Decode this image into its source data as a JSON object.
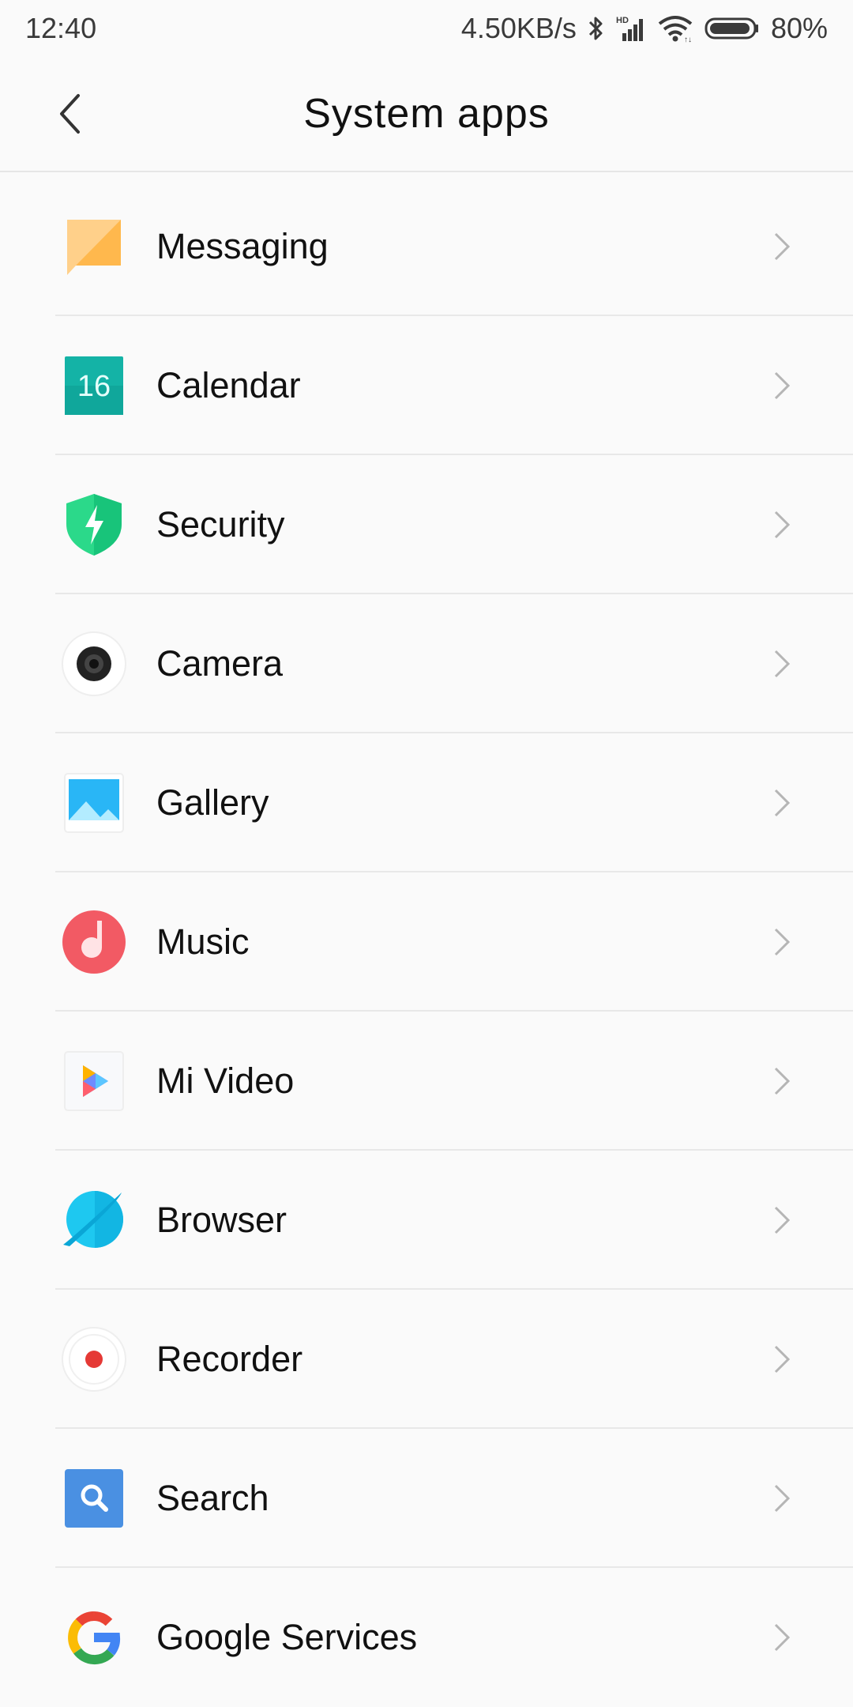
{
  "status_bar": {
    "time": "12:40",
    "speed": "4.50KB/s",
    "battery_percent": "80%",
    "icons": [
      "bluetooth-icon",
      "hd-signal-icon",
      "wifi-icon",
      "battery-icon"
    ]
  },
  "header": {
    "back_icon": "chevron-left-icon",
    "title": "System apps"
  },
  "apps": [
    {
      "label": "Messaging",
      "icon": "messaging-icon"
    },
    {
      "label": "Calendar",
      "icon": "calendar-icon",
      "icon_text": "16"
    },
    {
      "label": "Security",
      "icon": "security-shield-icon"
    },
    {
      "label": "Camera",
      "icon": "camera-icon"
    },
    {
      "label": "Gallery",
      "icon": "gallery-icon"
    },
    {
      "label": "Music",
      "icon": "music-icon"
    },
    {
      "label": "Mi Video",
      "icon": "mi-video-icon"
    },
    {
      "label": "Browser",
      "icon": "browser-icon"
    },
    {
      "label": "Recorder",
      "icon": "recorder-icon"
    },
    {
      "label": "Search",
      "icon": "search-icon"
    },
    {
      "label": "Google Services",
      "icon": "google-icon"
    }
  ],
  "colors": {
    "background": "#fafafa",
    "divider": "#e8e8e8",
    "chevron": "#b5b5b5",
    "messaging": "#ffb74d",
    "calendar": "#14b3a6",
    "security": "#2bd98a",
    "music": "#f25a64",
    "browser": "#1ec8f0",
    "recorder": "#e53935",
    "search": "#4a90e2"
  }
}
